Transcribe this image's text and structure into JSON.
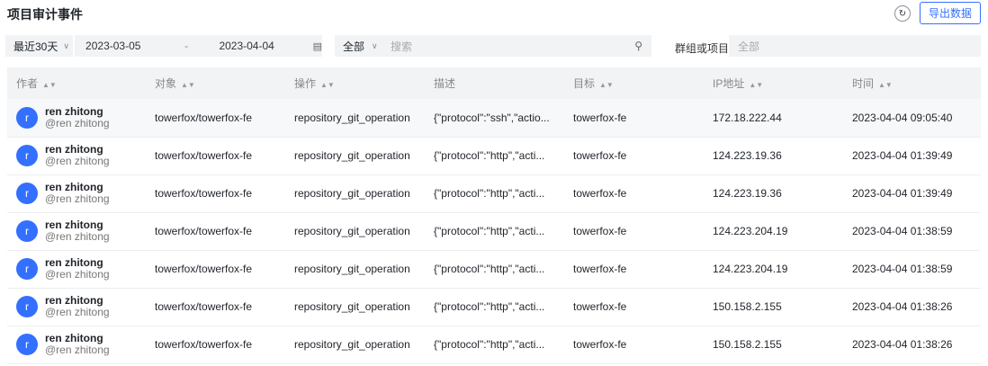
{
  "title": "项目审计事件",
  "export_label": "导出数据",
  "filters": {
    "preset": "最近30天",
    "start": "2023-03-05",
    "dash": "-",
    "end": "2023-04-04",
    "scope": "全部",
    "search_placeholder": "搜索",
    "group_label": "群组或项目",
    "group_placeholder": "全部"
  },
  "columns": [
    "作者",
    "对象",
    "操作",
    "描述",
    "目标",
    "IP地址",
    "时间"
  ],
  "rows": [
    {
      "avatar": "r",
      "name": "ren zhitong",
      "handle": "@ren zhitong",
      "object": "towerfox/towerfox-fe",
      "op": "repository_git_operation",
      "desc": "{\"protocol\":\"ssh\",\"actio...",
      "target": "towerfox-fe",
      "ip": "172.18.222.44",
      "time": "2023-04-04 09:05:40"
    },
    {
      "avatar": "r",
      "name": "ren zhitong",
      "handle": "@ren zhitong",
      "object": "towerfox/towerfox-fe",
      "op": "repository_git_operation",
      "desc": "{\"protocol\":\"http\",\"acti...",
      "target": "towerfox-fe",
      "ip": "124.223.19.36",
      "time": "2023-04-04 01:39:49"
    },
    {
      "avatar": "r",
      "name": "ren zhitong",
      "handle": "@ren zhitong",
      "object": "towerfox/towerfox-fe",
      "op": "repository_git_operation",
      "desc": "{\"protocol\":\"http\",\"acti...",
      "target": "towerfox-fe",
      "ip": "124.223.19.36",
      "time": "2023-04-04 01:39:49"
    },
    {
      "avatar": "r",
      "name": "ren zhitong",
      "handle": "@ren zhitong",
      "object": "towerfox/towerfox-fe",
      "op": "repository_git_operation",
      "desc": "{\"protocol\":\"http\",\"acti...",
      "target": "towerfox-fe",
      "ip": "124.223.204.19",
      "time": "2023-04-04 01:38:59"
    },
    {
      "avatar": "r",
      "name": "ren zhitong",
      "handle": "@ren zhitong",
      "object": "towerfox/towerfox-fe",
      "op": "repository_git_operation",
      "desc": "{\"protocol\":\"http\",\"acti...",
      "target": "towerfox-fe",
      "ip": "124.223.204.19",
      "time": "2023-04-04 01:38:59"
    },
    {
      "avatar": "r",
      "name": "ren zhitong",
      "handle": "@ren zhitong",
      "object": "towerfox/towerfox-fe",
      "op": "repository_git_operation",
      "desc": "{\"protocol\":\"http\",\"acti...",
      "target": "towerfox-fe",
      "ip": "150.158.2.155",
      "time": "2023-04-04 01:38:26"
    },
    {
      "avatar": "r",
      "name": "ren zhitong",
      "handle": "@ren zhitong",
      "object": "towerfox/towerfox-fe",
      "op": "repository_git_operation",
      "desc": "{\"protocol\":\"http\",\"acti...",
      "target": "towerfox-fe",
      "ip": "150.158.2.155",
      "time": "2023-04-04 01:38:26"
    }
  ]
}
